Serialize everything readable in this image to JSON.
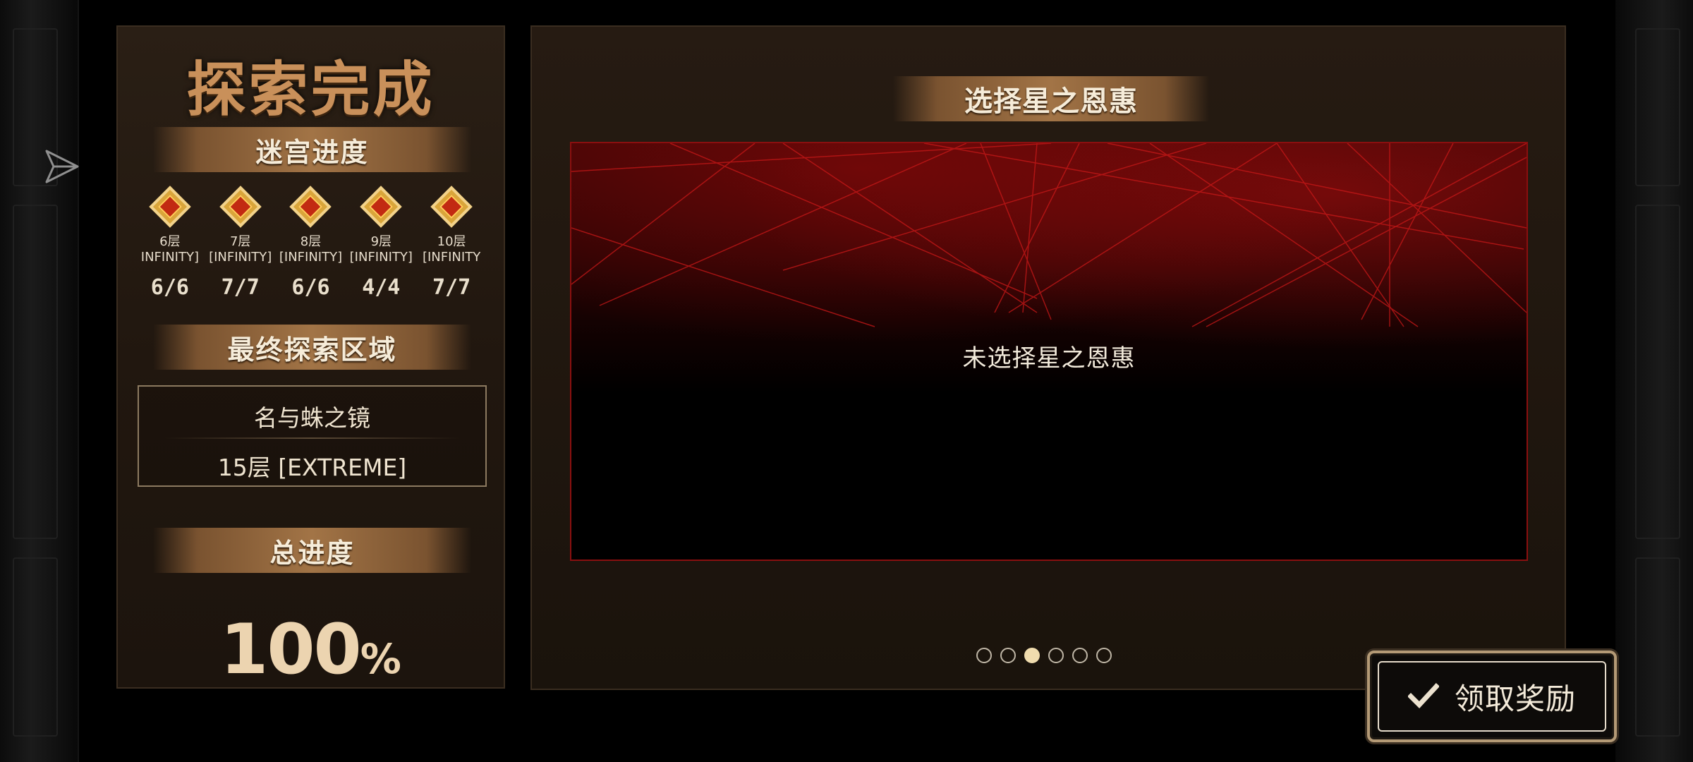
{
  "left_panel": {
    "title": "探索完成",
    "maze_progress_title": "迷宫进度",
    "floors": [
      {
        "label": "6层",
        "difficulty": "INFINITY]",
        "count": "6/6"
      },
      {
        "label": "7层",
        "difficulty": "[INFINITY]",
        "count": "7/7"
      },
      {
        "label": "8层",
        "difficulty": "[INFINITY]",
        "count": "6/6"
      },
      {
        "label": "9层",
        "difficulty": "[INFINITY]",
        "count": "4/4"
      },
      {
        "label": "10层",
        "difficulty": "[INFINITY",
        "count": "7/7"
      }
    ],
    "final_area_title": "最终探索区域",
    "final_area_name": "名与蛛之镜",
    "final_area_floor": "15层 [EXTREME]",
    "total_progress_title": "总进度",
    "total_progress_value": "100",
    "total_progress_unit": "%"
  },
  "right_panel": {
    "title": "选择星之恩惠",
    "empty_text": "未选择星之恩惠",
    "pagination": {
      "total": 6,
      "active_index": 2
    }
  },
  "claim_button": {
    "label": "领取奖励"
  },
  "icons": {
    "share": "share-icon",
    "check": "check-icon",
    "badge": "floor-badge-icon"
  },
  "colors": {
    "accent": "#c9905a",
    "frame_red": "#8a0f0f",
    "banner": "#a27446"
  }
}
